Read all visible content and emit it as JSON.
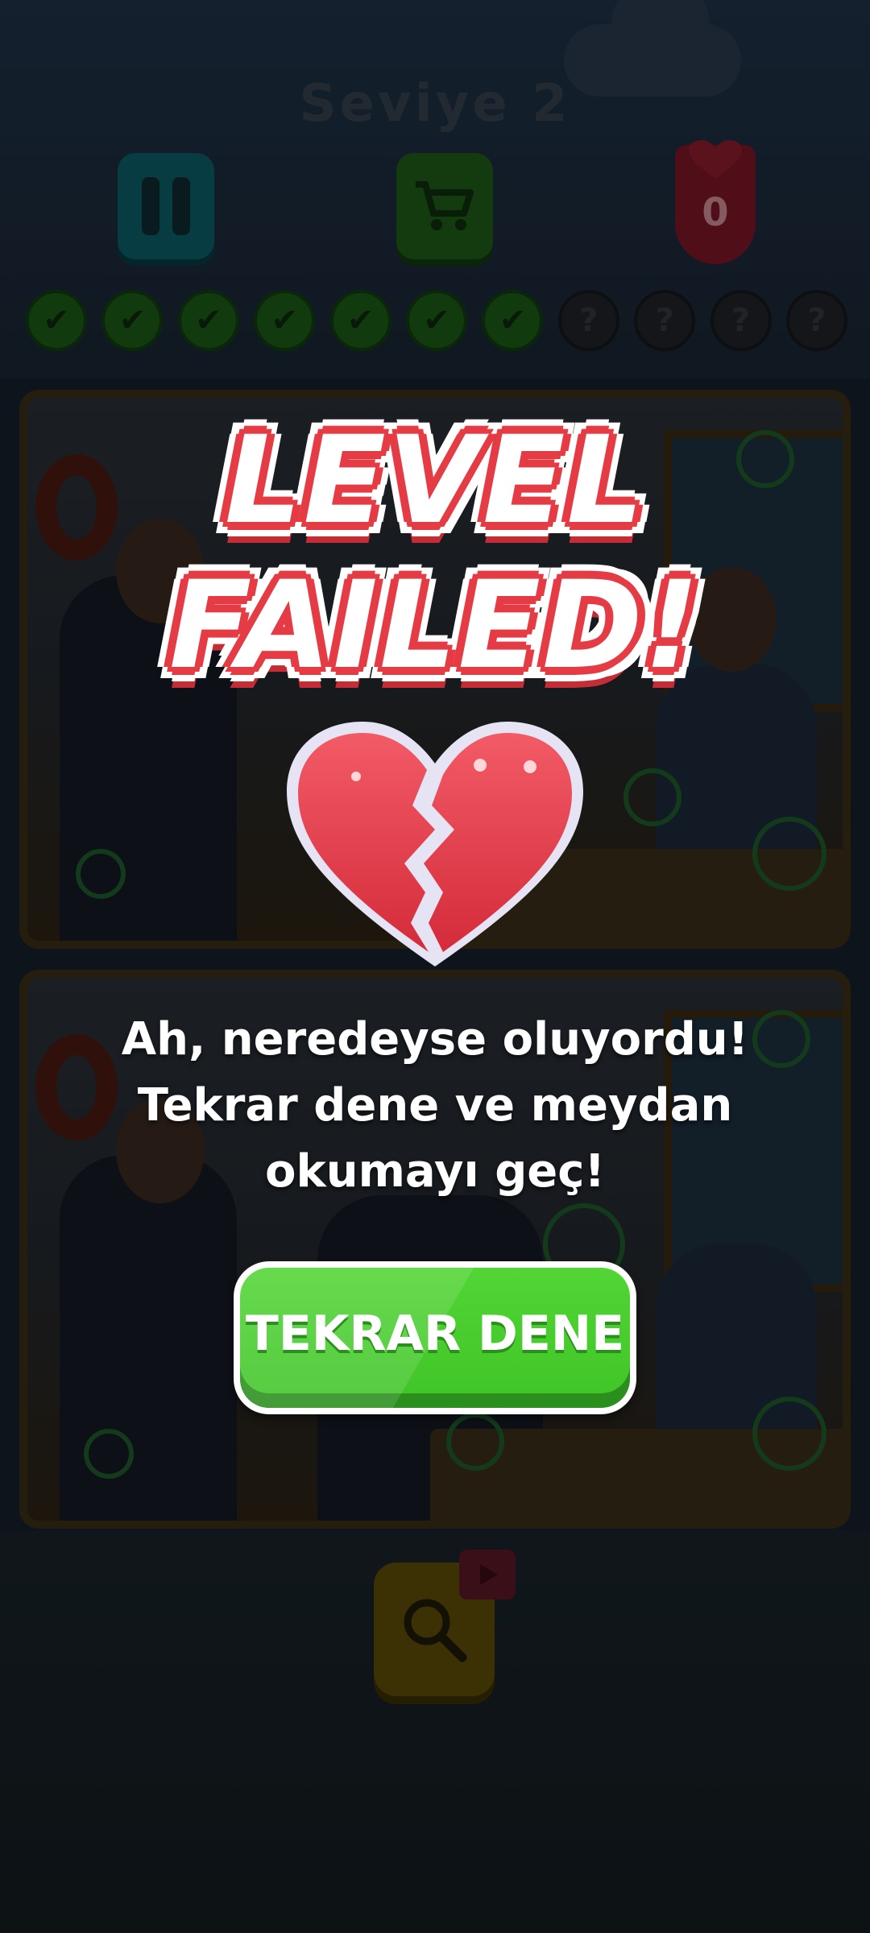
{
  "header": {
    "level_title": "Seviye  2",
    "lives_count": "0"
  },
  "progress": {
    "items": [
      {
        "state": "done",
        "symbol": "✔"
      },
      {
        "state": "done",
        "symbol": "✔"
      },
      {
        "state": "done",
        "symbol": "✔"
      },
      {
        "state": "done",
        "symbol": "✔"
      },
      {
        "state": "done",
        "symbol": "✔"
      },
      {
        "state": "done",
        "symbol": "✔"
      },
      {
        "state": "done",
        "symbol": "✔"
      },
      {
        "state": "todo",
        "symbol": "?"
      },
      {
        "state": "todo",
        "symbol": "?"
      },
      {
        "state": "todo",
        "symbol": "?"
      },
      {
        "state": "todo",
        "symbol": "?"
      }
    ]
  },
  "dialog": {
    "title_line1": "LEVEL",
    "title_line2": "FAILED!",
    "heart_icon": "broken-heart-icon",
    "message": "Ah, neredeyse oluyordu! Tekrar dene ve meydan okumayı geç!",
    "retry_label": "TEKRAR DENE"
  },
  "icons": {
    "pause": "pause-icon",
    "shop": "cart-icon",
    "lives": "heart-icon",
    "hint": "magnifier-icon",
    "video": "video-icon"
  },
  "colors": {
    "title_red": "#e53b44",
    "retry_green": "#3fc427",
    "heart_red": "#e8414f"
  }
}
